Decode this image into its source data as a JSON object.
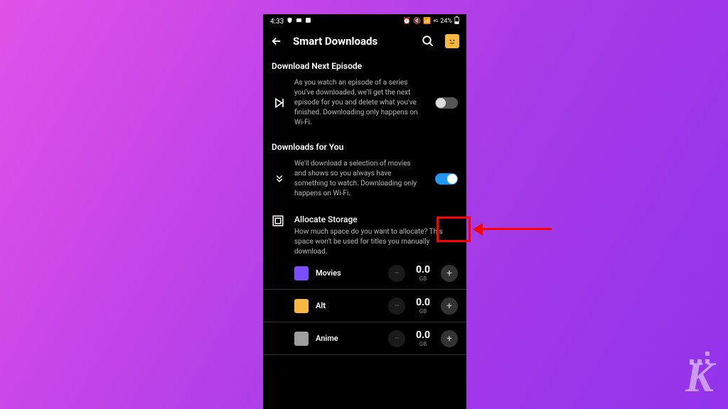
{
  "statusBar": {
    "time": "4:33",
    "batteryPct": "24%"
  },
  "header": {
    "title": "Smart Downloads"
  },
  "sections": {
    "downloadNext": {
      "title": "Download Next Episode",
      "desc": "As you watch an episode of a series you've downloaded, we'll get the next episode for you and delete what you've finished. Downloading only happens on Wi-Fi."
    },
    "downloadsForYou": {
      "title": "Downloads for You",
      "desc": "We'll download a selection of movies and shows so you always have something to watch. Downloading only happens on Wi-Fi."
    },
    "allocate": {
      "title": "Allocate Storage",
      "desc": "How much space do you want to allocate? This space won't be used for titles you manually download."
    }
  },
  "profiles": [
    {
      "name": "Movies",
      "value": "0.0",
      "unit": "GB",
      "color": "#7c4dff"
    },
    {
      "name": "Alt",
      "value": "0.0",
      "unit": "GB",
      "color": "#f5b942"
    },
    {
      "name": "Anime",
      "value": "0.0",
      "unit": "GB",
      "color": "#9e9e9e"
    }
  ],
  "watermark": "K"
}
